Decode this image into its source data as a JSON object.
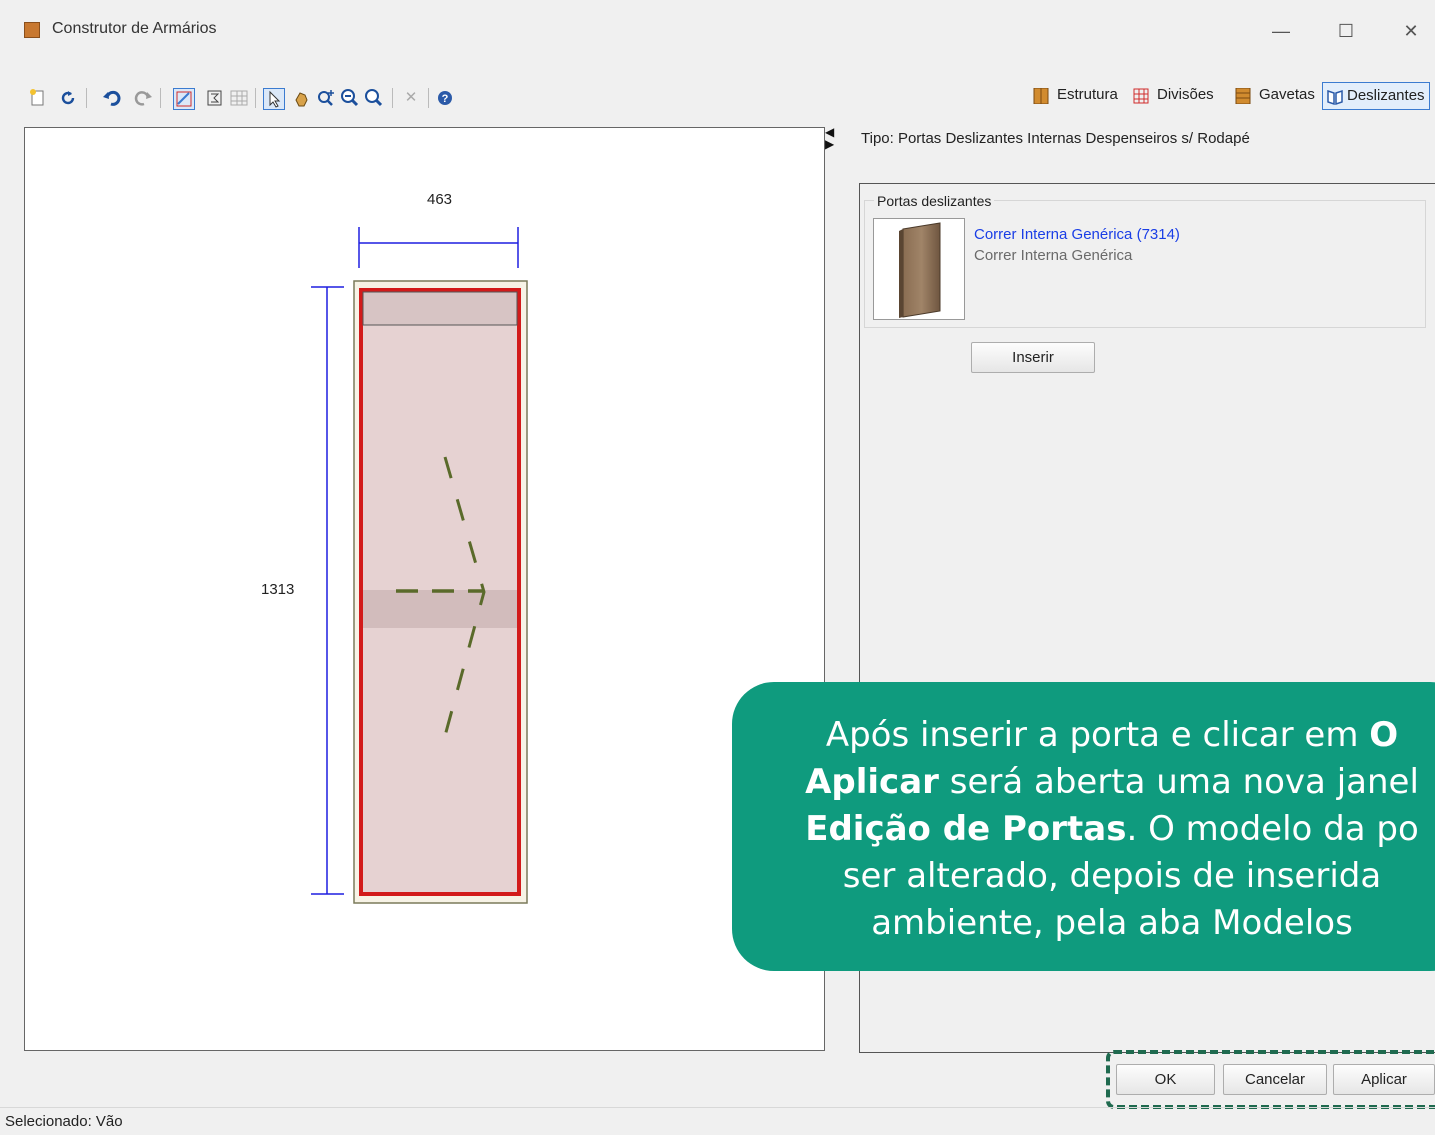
{
  "window": {
    "title": "Construtor de Armários",
    "minimize": "—",
    "maximize": "☐",
    "close": "✕"
  },
  "toolbar": {
    "icons": [
      "new-icon",
      "refresh-icon",
      "undo-icon",
      "redo-icon",
      "select-area-icon",
      "sum-icon",
      "grid-icon",
      "pointer-icon",
      "pan-icon",
      "zoom-in-icon",
      "zoom-out-icon",
      "zoom-fit-icon",
      "delete-icon",
      "help-icon"
    ],
    "tabs": [
      {
        "label": "Estrutura",
        "icon": "wardrobe-icon",
        "color": "#d18b2f"
      },
      {
        "label": "Divisões",
        "icon": "grid-icon",
        "color": "#d02b2b"
      },
      {
        "label": "Gavetas",
        "icon": "drawers-icon",
        "color": "#d18b2f"
      },
      {
        "label": "Deslizantes",
        "icon": "sliding-doors-icon",
        "color": "#2b5aa8",
        "selected": true
      }
    ]
  },
  "drawing": {
    "width_label": "463",
    "height_label": "1313",
    "dimension_color": "#1f1fe0",
    "frame_color": "#d21b1b",
    "fill_color": "#e6d2d2",
    "hinge_line_color": "#5a6a2a"
  },
  "panel": {
    "tipo": "Tipo: Portas Deslizantes Internas Despenseiros s/ Rodapé",
    "group_label": "Portas deslizantes",
    "door_name": "Correr Interna Genérica (7314)",
    "door_sub": "Correr Interna Genérica",
    "insert_button": "Inserir"
  },
  "callout": {
    "l1_a": "Após inserir a porta e clicar em ",
    "l1_b": "O",
    "l2_a": "Aplicar",
    "l2_b": " será aberta uma nova janel",
    "l3_a": "Edição de Portas",
    "l3_b": ". O modelo da po",
    "l4": "ser alterado, depois de inserida",
    "l5": "ambiente, pela aba Modelos",
    "color": "#0f9b7e"
  },
  "footer": {
    "ok": "OK",
    "cancel": "Cancelar",
    "apply": "Aplicar",
    "status": "Selecionado: Vão"
  }
}
